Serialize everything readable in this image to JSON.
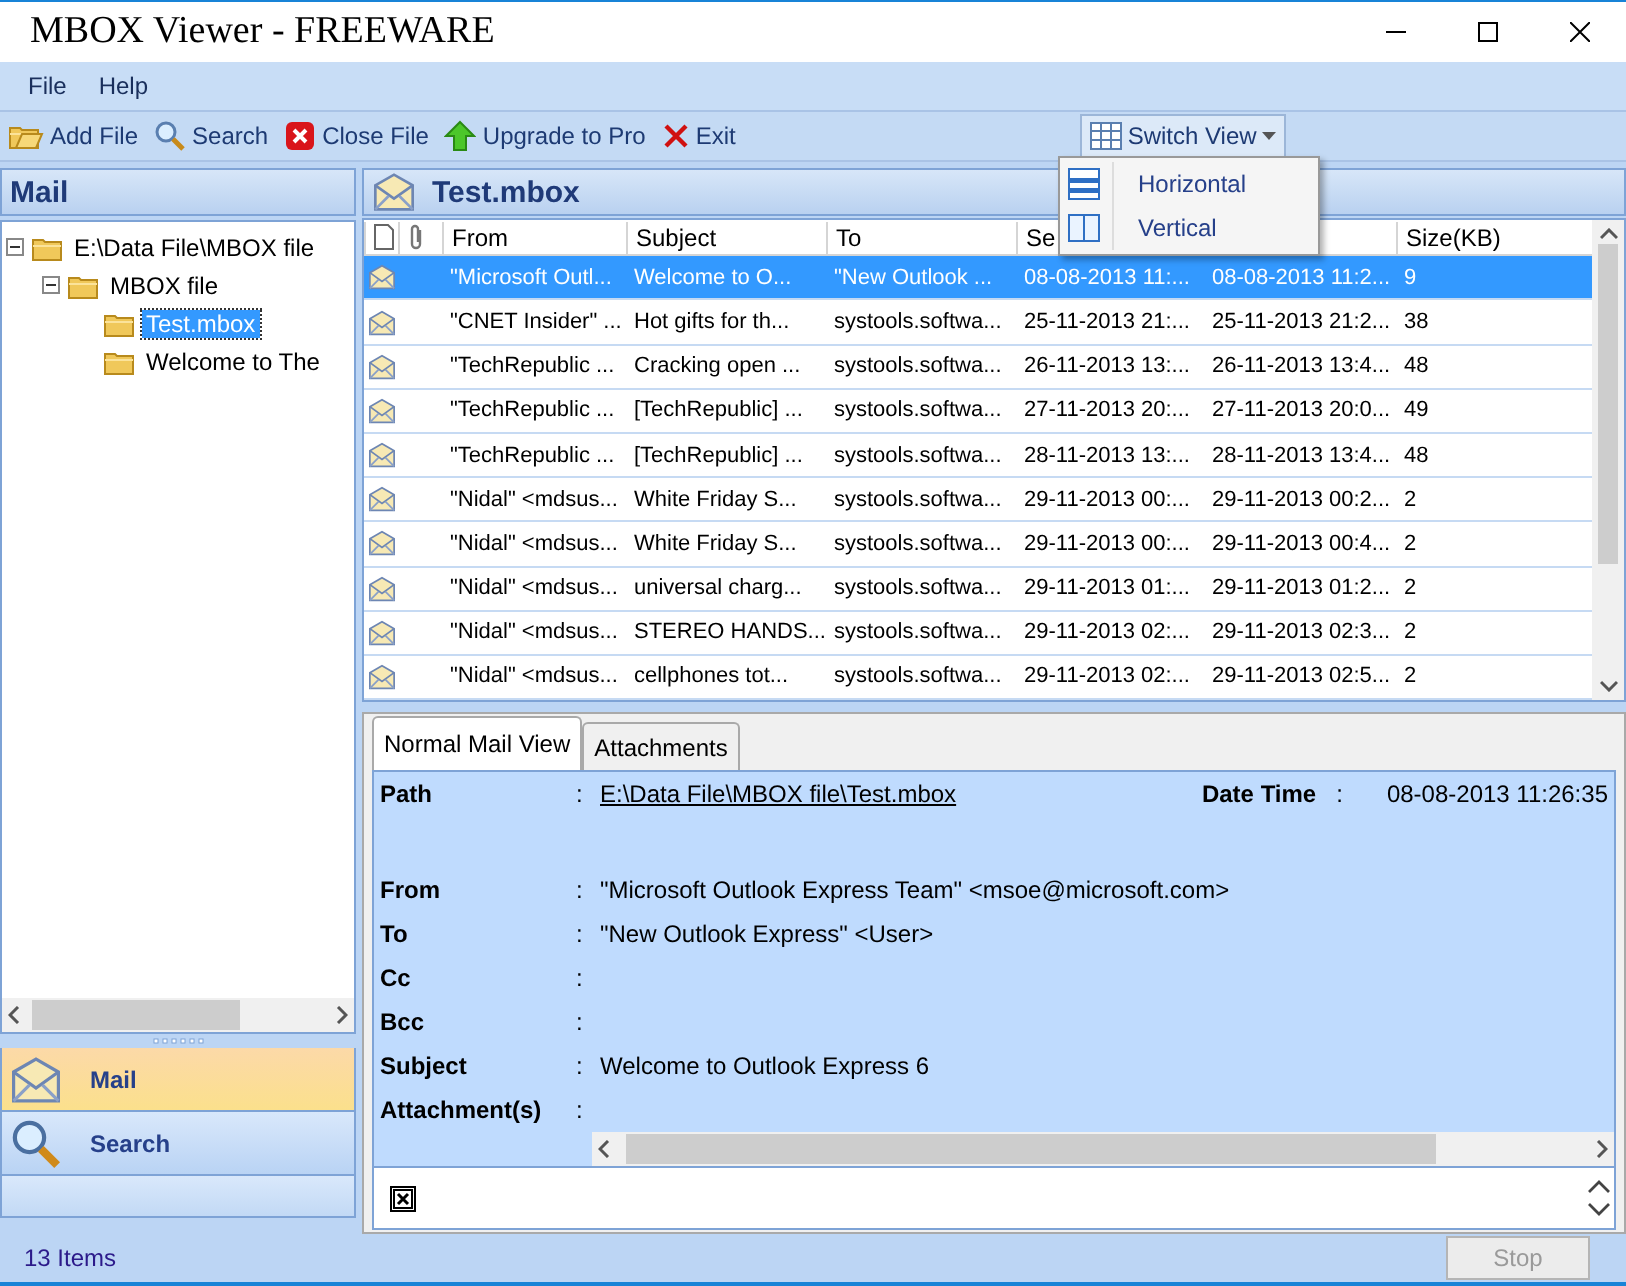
{
  "window": {
    "title": "MBOX Viewer - FREEWARE"
  },
  "menu": [
    "File",
    "Help"
  ],
  "toolbar": [
    {
      "label": "Add File"
    },
    {
      "label": "Search"
    },
    {
      "label": "Close File"
    },
    {
      "label": "Upgrade to Pro"
    },
    {
      "label": "Exit"
    }
  ],
  "switch_view": {
    "label": "Switch View",
    "expanded": true,
    "items": [
      {
        "label": "Horizontal"
      },
      {
        "label": "Vertical"
      }
    ]
  },
  "sidebar": {
    "title": "Mail",
    "tree": [
      {
        "label": "E:\\Data File\\MBOX file",
        "expanded": true,
        "selected": false,
        "children": [
          {
            "label": "MBOX file",
            "expanded": true,
            "selected": false,
            "children": [
              {
                "label": "Test.mbox",
                "selected": true
              },
              {
                "label": "Welcome to The",
                "selected": false
              }
            ]
          }
        ]
      }
    ],
    "nav": [
      {
        "label": "Mail",
        "selected": true
      },
      {
        "label": "Search",
        "selected": false
      }
    ]
  },
  "mailbox": {
    "title": "Test.mbox",
    "columns": [
      {
        "label": "From"
      },
      {
        "label": "Subject"
      },
      {
        "label": "To"
      },
      {
        "label": "Se"
      },
      {},
      {
        "label": "Size(KB)"
      }
    ],
    "rows": [
      {
        "selected": true,
        "cells": [
          "\"Microsoft Outl...",
          "Welcome to O...",
          "\"New Outlook ...",
          "08-08-2013 11:...",
          "08-08-2013 11:2...",
          "9"
        ]
      },
      {
        "selected": false,
        "cells": [
          "\"CNET Insider\" ...",
          "Hot gifts for th...",
          "systools.softwa...",
          "25-11-2013 21:...",
          "25-11-2013 21:2...",
          "38"
        ]
      },
      {
        "selected": false,
        "cells": [
          "\"TechRepublic ...",
          "Cracking open ...",
          "systools.softwa...",
          "26-11-2013 13:...",
          "26-11-2013 13:4...",
          "48"
        ]
      },
      {
        "selected": false,
        "cells": [
          "\"TechRepublic ...",
          "[TechRepublic] ...",
          "systools.softwa...",
          "27-11-2013 20:...",
          "27-11-2013 20:0...",
          "49"
        ]
      },
      {
        "selected": false,
        "cells": [
          "\"TechRepublic ...",
          "[TechRepublic] ...",
          "systools.softwa...",
          "28-11-2013 13:...",
          "28-11-2013 13:4...",
          "48"
        ]
      },
      {
        "selected": false,
        "cells": [
          "\"Nidal\" <mdsus...",
          "White Friday S...",
          "systools.softwa...",
          "29-11-2013 00:...",
          "29-11-2013 00:2...",
          "2"
        ]
      },
      {
        "selected": false,
        "cells": [
          "\"Nidal\" <mdsus...",
          "White Friday S...",
          "systools.softwa...",
          "29-11-2013 00:...",
          "29-11-2013 00:4...",
          "2"
        ]
      },
      {
        "selected": false,
        "cells": [
          "\"Nidal\" <mdsus...",
          "universal charg...",
          "systools.softwa...",
          "29-11-2013 01:...",
          "29-11-2013 01:2...",
          "2"
        ]
      },
      {
        "selected": false,
        "cells": [
          "\"Nidal\" <mdsus...",
          "STEREO HANDS...",
          "systools.softwa...",
          "29-11-2013 02:...",
          "29-11-2013 02:3...",
          "2"
        ]
      },
      {
        "selected": false,
        "cells": [
          "\"Nidal\" <mdsus...",
          "cellphones tot...",
          "systools.softwa...",
          "29-11-2013 02:...",
          "29-11-2013 02:5...",
          "2"
        ]
      }
    ]
  },
  "tabs": [
    {
      "label": "Normal Mail View",
      "selected": true
    },
    {
      "label": "Attachments",
      "selected": false
    }
  ],
  "details": {
    "path": {
      "label": "Path",
      "value": "E:\\Data File\\MBOX file\\Test.mbox"
    },
    "date_time": {
      "label": "Date Time",
      "value": "08-08-2013 11:26:35"
    },
    "fields": [
      {
        "label": "From",
        "value": "\"Microsoft Outlook Express Team\" <msoe@microsoft.com>"
      },
      {
        "label": "To",
        "value": "\"New Outlook Express\" <User>"
      },
      {
        "label": "Cc"
      },
      {
        "label": "Bcc"
      },
      {
        "label": "Subject",
        "value": "Welcome to Outlook Express 6"
      },
      {
        "label": "Attachment(s)"
      }
    ],
    "separator": ":"
  },
  "status_bar": {
    "count": "13 Items",
    "stop_button": {
      "label": "Stop",
      "disabled": true
    }
  }
}
